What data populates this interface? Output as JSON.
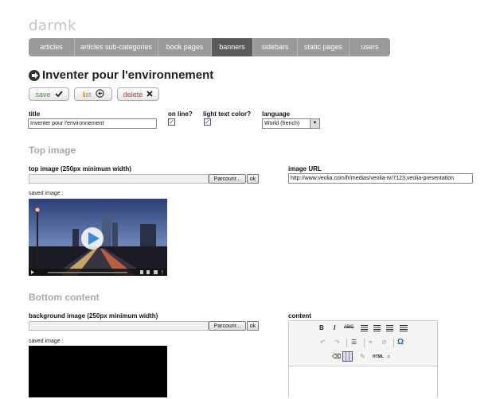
{
  "logo": "darmk",
  "tabs": [
    "articles",
    "articles sub-categories",
    "book pages",
    "banners",
    "sidebars",
    "static pages",
    "users"
  ],
  "active_tab": "banners",
  "page_title": "Inventer pour l'environnement",
  "actions": {
    "save": "save",
    "list": "list",
    "delete": "delete"
  },
  "form": {
    "title_label": "title",
    "title_value": "Inventer pour l'environnement",
    "online_label": "on line?",
    "online_checked": true,
    "light_label": "light text color?",
    "light_checked": true,
    "language_label": "language",
    "language_value": "World (french)"
  },
  "top_image": {
    "section_title": "Top image",
    "upload_label": "top image (250px minimum width)",
    "browse_label": "Parcourir...",
    "ok_label": "ok",
    "saved_label": "saved image :",
    "url_label": "image URL",
    "url_value": "http://www.veolia.com/fr/medias/veolia-tv/7123,veolia-presentation"
  },
  "bottom": {
    "section_title": "Bottom content",
    "upload_label": "background image (250px minimum width)",
    "browse_label": "Parcourir...",
    "ok_label": "ok",
    "saved_label": "saved image :",
    "content_label": "content"
  },
  "colors": {
    "tab_bar": "#9a9a9a",
    "tab_active": "#5a5a5a",
    "section": "#a9a9a9",
    "save": "#3a9a3a",
    "list": "#c8761e",
    "delete": "#c83030"
  }
}
